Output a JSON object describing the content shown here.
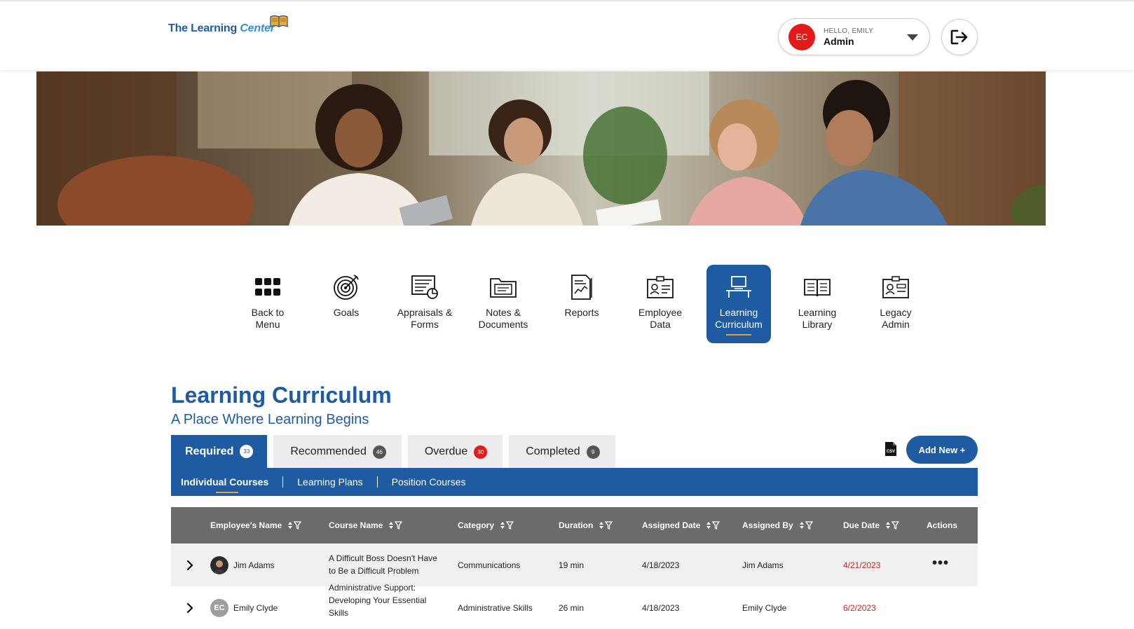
{
  "header": {
    "logo_text_main": "The Learning",
    "logo_text_accent": "Center",
    "user_initials": "EC",
    "greeting": "HELLO, EMILY",
    "role": "Admin"
  },
  "nav": [
    {
      "line1": "Back to",
      "line2": "Menu"
    },
    {
      "line1": "Goals",
      "line2": ""
    },
    {
      "line1": "Appraisals &",
      "line2": "Forms"
    },
    {
      "line1": "Notes &",
      "line2": "Documents"
    },
    {
      "line1": "Reports",
      "line2": ""
    },
    {
      "line1": "Employee",
      "line2": "Data"
    },
    {
      "line1": "Learning",
      "line2": "Curriculum"
    },
    {
      "line1": "Learning",
      "line2": "Library"
    },
    {
      "line1": "Legacy",
      "line2": "Admin"
    }
  ],
  "page": {
    "title": "Learning Curriculum",
    "subtitle": "A Place Where Learning Begins"
  },
  "tabs": [
    {
      "label": "Required",
      "count": "33"
    },
    {
      "label": "Recommended",
      "count": "46"
    },
    {
      "label": "Overdue",
      "count": "30"
    },
    {
      "label": "Completed",
      "count": "9"
    }
  ],
  "actions": {
    "csv_label": "CSV",
    "add_new": "Add New +"
  },
  "subnav": [
    "Individual Courses",
    "Learning Plans",
    "Position Courses"
  ],
  "table": {
    "columns": [
      "Employee's Name",
      "Course Name",
      "Category",
      "Duration",
      "Assigned Date",
      "Assigned By",
      "Due Date",
      "Actions"
    ],
    "rows": [
      {
        "employee": "Jim Adams",
        "course_line1": "A Difficult Boss Doesn't Have",
        "course_line2": "to Be a Difficult Problem",
        "course_line3": "",
        "category": "Communications",
        "duration": "19 min",
        "assigned_date": "4/18/2023",
        "assigned_by": "Jim Adams",
        "due_date": "4/21/2023",
        "actions": "•••"
      },
      {
        "employee": "Emily Clyde",
        "initials": "EC",
        "course_line1": "Administrative Support:",
        "course_line2": "Developing Your Essential",
        "course_line3": "Skills",
        "category": "Administrative Skills",
        "duration": "26 min",
        "assigned_date": "4/18/2023",
        "assigned_by": "Emily Clyde",
        "due_date": "6/2/2023"
      }
    ]
  },
  "colors": {
    "primary": "#1e5ba3",
    "alert": "#e21a1a",
    "header_gray": "#6b6b6b",
    "accent": "#f0a030"
  }
}
